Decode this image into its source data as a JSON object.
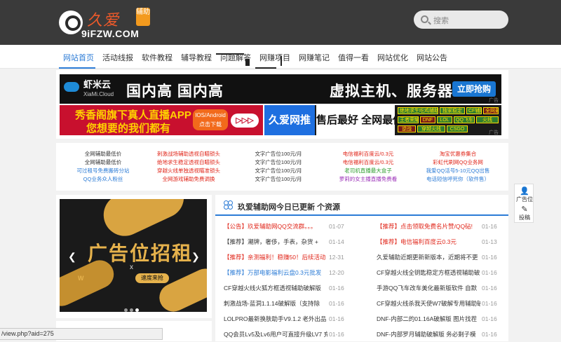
{
  "header": {
    "brand_cn": "久爱",
    "badge": "辅助",
    "domain": "9iFZW.COM",
    "search_placeholder": "搜索"
  },
  "nav": {
    "items": [
      "网站首页",
      "活动线报",
      "软件教程",
      "辅导教程",
      "问题解答",
      "网赚项目",
      "网赚笔记",
      "值得一看",
      "网站优化",
      "网站公告"
    ],
    "active": "网站首页"
  },
  "banners": {
    "banner1": {
      "logo": "虾米云",
      "logo_en": "XiaMi.Cloud",
      "text1": "国内高 国内高",
      "text2": "虚拟主机、服务器",
      "button": "立即抢购",
      "tag": "广告"
    },
    "banner2": {
      "line1": "秀香阁旗下真人直播APP",
      "line2": "您想要的我们都有",
      "pill": "IOS/Android 点击下载",
      "arrows": "▷▷▷"
    },
    "banner3": {
      "left": "久爱网推荐",
      "mid": "售后最好 全网最低",
      "grid": [
        "绝地求生吃鸡辅助",
        "独家稳定",
        "CF辅助",
        "全网最低",
        "王者荣耀",
        "DNF",
        "LOL",
        "QQ飞车",
        "火线",
        "逆战",
        "穿越火线",
        "CSGO"
      ],
      "tag": "广告"
    }
  },
  "links": {
    "columns": [
      {
        "color": "#333333",
        "items": [
          "全网辅助最低价",
          "全网辅助最低价",
          "可过租号免费搬砖分站",
          "QQ业务众人粉丝"
        ]
      },
      {
        "color": "#e0261a",
        "items": [
          "刺激战场辅助透视自瞄锁头",
          "绝地求生稳定透视自瞄锁头",
          "穿越火线单独透视瞄准锁头",
          "全网游戏辅助免费调换"
        ]
      },
      {
        "color": "#333333",
        "items": [
          "文字广告位100元/月",
          "文字广告位100元/月",
          "文字广告位100元/月",
          "文字广告位100元/月"
        ]
      },
      {
        "color": "#e0261a",
        "items": [
          "电信福利百度云/0.3元",
          "电信福利百度云/0.3元",
          "老司机直播最大盒子",
          "萝莉的女主播直播免费看"
        ]
      },
      {
        "color": "#e0261a",
        "items": [
          "淘宝优惠券集合",
          "彩虹代刷网QQ业务网",
          "我爱QQ活号5-10元QQ出售",
          "电话短信呼死你（软件售）"
        ]
      }
    ]
  },
  "carousel": {
    "title": "广告位招租",
    "x": "x",
    "sub": "速度来抢",
    "brand": "W"
  },
  "updates": {
    "title": "玖爱辅助网今日已更新 个资源",
    "left": [
      {
        "title": "【公告】玖爱辅助网QQ交流群。。。",
        "date": "01-07",
        "color": "#e0261a"
      },
      {
        "title": "【推荐】潮牌，奢侈，手表，杂货 +",
        "date": "01-14",
        "color": "#333333"
      },
      {
        "title": "【推荐】亲测福利！稳赚50！后续活动",
        "date": "12-31",
        "color": "#e0261a"
      },
      {
        "title": "【推荐】万部电影福利云盘0.3元批发",
        "date": "12-20",
        "color": "#2b7bd6"
      },
      {
        "title": "CF穿越火线火狐方框透视辅助破解版",
        "date": "01-16",
        "color": "#333333"
      },
      {
        "title": "刺激战场-蓝洞1.1.14破解版（支持除",
        "date": "01-16",
        "color": "#333333"
      },
      {
        "title": "LOLPRO最新换肤助手V9.1.2 老外出品",
        "date": "01-16",
        "color": "#333333"
      },
      {
        "title": "QQ会员Lv5及Lv6用户可直接升级LV7 充",
        "date": "01-16",
        "color": "#333333"
      }
    ],
    "right": [
      {
        "title": "【推荐】点击领取免费名片赞/QQ砧!",
        "date": "01-16",
        "color": "#e0261a"
      },
      {
        "title": "【推荐】电信福利百度云0.3元",
        "date": "01-13",
        "color": "#e0261a"
      },
      {
        "title": "久爱辅助近期更新新版本，近期将不更",
        "date": "01-16",
        "color": "#333333"
      },
      {
        "title": "CF穿越火线全钥匙稳定方框透视辅助破",
        "date": "01-16",
        "color": "#333333"
      },
      {
        "title": "手游QQ飞车改车美化最新版软件 自默",
        "date": "01-16",
        "color": "#333333"
      },
      {
        "title": "CF穿越火线杀我天使W7破解专用辅助破",
        "date": "01-16",
        "color": "#333333"
      },
      {
        "title": "DNF-内部二的01.16A破解版 图片找茬",
        "date": "01-16",
        "color": "#333333"
      },
      {
        "title": "DNF-内部罗月辅助破解版 务必剩子模",
        "date": "01-16",
        "color": "#333333"
      }
    ]
  },
  "float": {
    "ad_label": "广告位",
    "submit_label": "投稿"
  },
  "status_bar": "/view.php?aid=275"
}
